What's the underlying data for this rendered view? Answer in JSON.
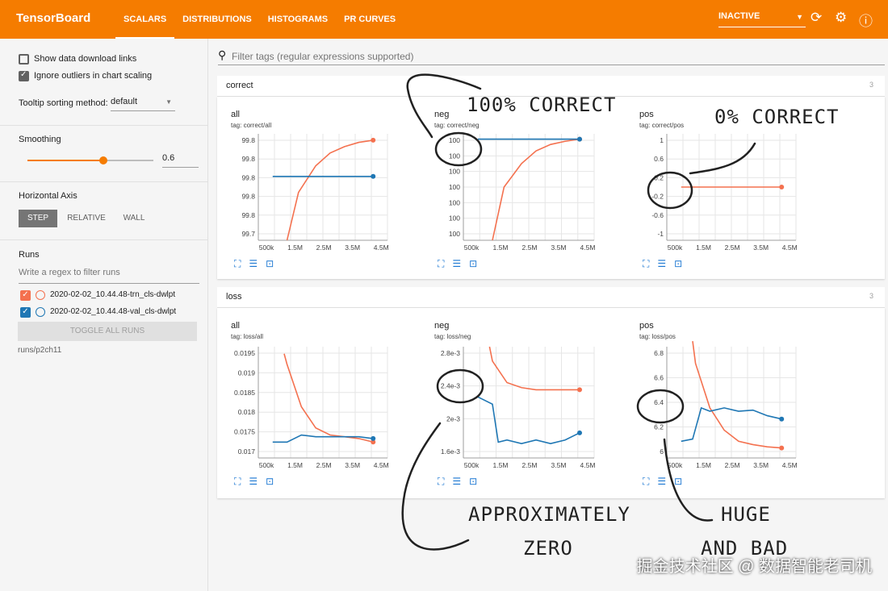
{
  "app": {
    "title": "TensorBoard"
  },
  "tabs": [
    {
      "label": "SCALARS"
    },
    {
      "label": "DISTRIBUTIONS"
    },
    {
      "label": "HISTOGRAMS"
    },
    {
      "label": "PR CURVES"
    }
  ],
  "run_selector": {
    "value": "INACTIVE"
  },
  "icons": {
    "refresh": "refresh-icon",
    "settings": "gear-icon",
    "help": "help-icon"
  },
  "colors": {
    "accent": "#f57c00",
    "orange_run": "#f4714f",
    "blue_run": "#1f77b4"
  },
  "sidebar": {
    "show_download": "Show data download links",
    "ignore_outliers": "Ignore outliers in chart scaling",
    "tooltip_label": "Tooltip sorting method:",
    "tooltip_value": "default",
    "smoothing_label": "Smoothing",
    "smoothing_value": "0.6",
    "smoothing_level": 0.6,
    "haxis_label": "Horizontal Axis",
    "haxis_options": [
      "STEP",
      "RELATIVE",
      "WALL"
    ],
    "runs_label": "Runs",
    "runs_placeholder": "Write a regex to filter runs",
    "runs": [
      {
        "name": "2020-02-02_10.44.48-trn_cls-dwlpt",
        "color": "#f4714f"
      },
      {
        "name": "2020-02-02_10.44.48-val_cls-dwlpt",
        "color": "#1f77b4"
      }
    ],
    "toggle_all": "TOGGLE ALL RUNS",
    "footer": "runs/p2ch11"
  },
  "filter": {
    "placeholder": "Filter tags (regular expressions supported)"
  },
  "categories": [
    {
      "name": "correct",
      "count": "3"
    },
    {
      "name": "loss",
      "count": "3"
    }
  ],
  "chart_data": [
    {
      "type": "line",
      "title": "all",
      "tag": "tag: correct/all",
      "yticks": [
        "99.8",
        "99.8",
        "99.8",
        "99.8",
        "99.8",
        "99.7"
      ],
      "xticks": [
        "500k",
        "1.5M",
        "2.5M",
        "3.5M",
        "4.5M"
      ],
      "series": [
        {
          "x": [
            1.5,
            1.9,
            2.5,
            3.0,
            3.5,
            4.0,
            4.5
          ],
          "y": [
            0.0,
            0.45,
            0.7,
            0.82,
            0.88,
            0.92,
            0.94
          ]
        },
        {
          "x": [
            1.0,
            4.5
          ],
          "y": [
            0.6,
            0.6
          ]
        }
      ]
    },
    {
      "type": "line",
      "title": "neg",
      "tag": "tag: correct/neg",
      "yticks": [
        "100",
        "100",
        "100",
        "100",
        "100",
        "100",
        "100"
      ],
      "xticks": [
        "500k",
        "1.5M",
        "2.5M",
        "3.5M",
        "4.5M"
      ],
      "series": [
        {
          "x": [
            1.5,
            1.9,
            2.5,
            3.0,
            3.5,
            4.0,
            4.5
          ],
          "y": [
            0.0,
            0.5,
            0.72,
            0.84,
            0.9,
            0.93,
            0.95
          ]
        },
        {
          "x": [
            1.0,
            4.5
          ],
          "y": [
            0.95,
            0.95
          ]
        }
      ]
    },
    {
      "type": "line",
      "title": "pos",
      "tag": "tag: correct/pos",
      "yticks": [
        "1",
        "0.6",
        "0.2",
        "-0.2",
        "-0.6",
        "-1"
      ],
      "xticks": [
        "500k",
        "1.5M",
        "2.5M",
        "3.5M",
        "4.5M"
      ],
      "series": [
        {
          "x": [
            1.0,
            4.5
          ],
          "y": [
            0,
            0
          ]
        }
      ]
    },
    {
      "type": "line",
      "title": "all",
      "tag": "tag: loss/all",
      "yticks": [
        "0.0195",
        "0.019",
        "0.0185",
        "0.018",
        "0.0175",
        "0.017"
      ],
      "xticks": [
        "500k",
        "1.5M",
        "2.5M",
        "3.5M",
        "4.5M"
      ],
      "series": [
        {
          "x": [
            1.4,
            1.5,
            2.0,
            2.5,
            3.0,
            3.5,
            4.0,
            4.5
          ],
          "y": [
            0.0198,
            0.0195,
            0.0183,
            0.0177,
            0.0175,
            0.01745,
            0.0174,
            0.0173
          ]
        },
        {
          "x": [
            1.0,
            1.5,
            2.0,
            2.5,
            3.0,
            3.5,
            4.0,
            4.5
          ],
          "y": [
            0.0173,
            0.0173,
            0.0175,
            0.01745,
            0.01745,
            0.01745,
            0.01745,
            0.0174
          ]
        }
      ]
    },
    {
      "type": "line",
      "title": "neg",
      "tag": "tag: loss/neg",
      "yticks": [
        "2.8e-3",
        "2.4e-3",
        "2e-3",
        "1.6e-3"
      ],
      "xticks": [
        "500k",
        "1.5M",
        "2.5M",
        "3.5M",
        "4.5M"
      ],
      "series": [
        {
          "x": [
            1.4,
            1.5,
            2.0,
            2.5,
            3.0,
            3.5,
            4.0,
            4.5
          ],
          "y": [
            0.003,
            0.0028,
            0.0025,
            0.00243,
            0.0024,
            0.0024,
            0.0024,
            0.0024
          ]
        },
        {
          "x": [
            1.0,
            1.5,
            1.7,
            2.0,
            2.5,
            3.0,
            3.5,
            4.0,
            4.5
          ],
          "y": [
            0.0023,
            0.0022,
            0.00167,
            0.0017,
            0.00165,
            0.0017,
            0.00165,
            0.0017,
            0.0018
          ]
        }
      ]
    },
    {
      "type": "line",
      "title": "pos",
      "tag": "tag: loss/pos",
      "yticks": [
        "6.8",
        "6.6",
        "6.4",
        "6.2",
        "6"
      ],
      "xticks": [
        "500k",
        "1.5M",
        "2.5M",
        "3.5M",
        "4.5M"
      ],
      "series": [
        {
          "x": [
            1.4,
            1.5,
            2.0,
            2.5,
            3.0,
            3.5,
            4.0,
            4.5
          ],
          "y": [
            7.0,
            6.8,
            6.4,
            6.2,
            6.1,
            6.07,
            6.05,
            6.04
          ]
        },
        {
          "x": [
            1.0,
            1.4,
            1.7,
            2.0,
            2.5,
            3.0,
            3.5,
            4.0,
            4.5
          ],
          "y": [
            6.1,
            6.12,
            6.4,
            6.37,
            6.4,
            6.37,
            6.38,
            6.33,
            6.3
          ]
        }
      ]
    }
  ],
  "annotations": {
    "a1": "100% CORRECT",
    "a2": "0% CORRECT",
    "a3": "APPROXIMATELY",
    "a4": "ZERO",
    "a5": "HUGE",
    "a6": "AND BAD"
  },
  "watermark": "掘金技术社区 @ 数据智能老司机"
}
